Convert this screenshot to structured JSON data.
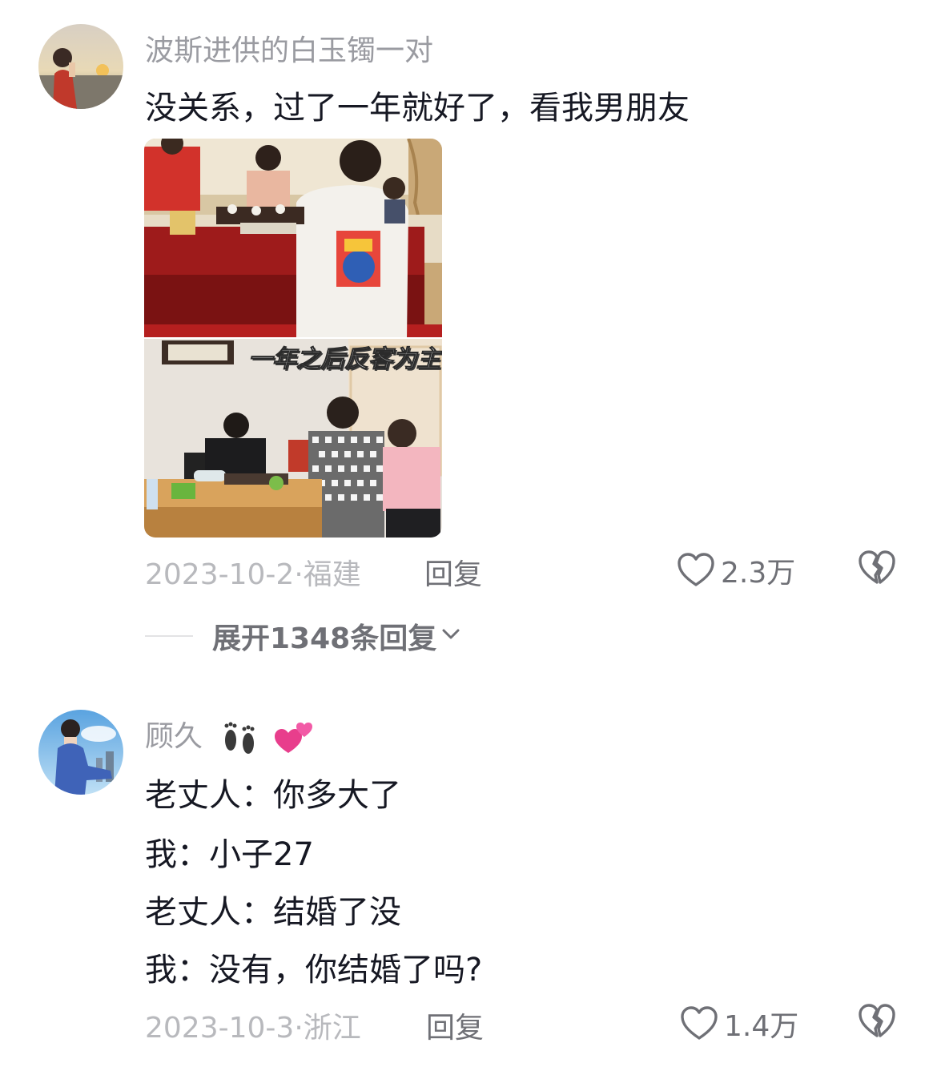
{
  "comments": [
    {
      "username": "波斯进供的白玉镯一对",
      "text_lines": [
        "没关系，过了一年就好了，看我男朋友"
      ],
      "image_caption": "一年之后反客为主",
      "date": "2023-10-2",
      "location": "福建",
      "reply_label": "回复",
      "likes": "2.3万",
      "icons": [
        "heart-icon",
        "broken-heart-icon"
      ],
      "replies_toggle": "展开1348条回复"
    },
    {
      "username": "顾久",
      "username_emoji": [
        "footprints-emoji",
        "two-hearts-emoji"
      ],
      "text_lines": [
        "老丈人：你多大了",
        "我：小子27",
        "老丈人：结婚了没",
        "我：没有，你结婚了吗?"
      ],
      "date": "2023-10-3",
      "location": "浙江",
      "reply_label": "回复",
      "likes": "1.4万",
      "icons": [
        "heart-icon",
        "broken-heart-icon"
      ]
    }
  ],
  "colors": {
    "text_primary": "#161823",
    "text_secondary": "#9a9ba1",
    "meta": "#b8b9bd",
    "action": "#6f7076"
  }
}
